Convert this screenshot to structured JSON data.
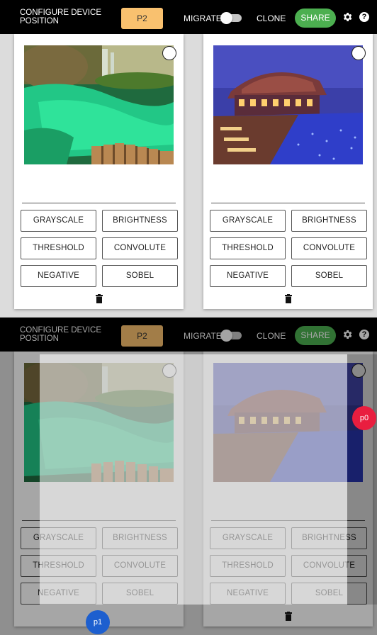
{
  "toolbar": {
    "title": "CONFIGURE DEVICE POSITION",
    "device_button": "P2",
    "migrate_label": "MIGRATE",
    "clone_label": "CLONE",
    "share_label": "SHARE",
    "icons": [
      "gear-icon",
      "help-icon"
    ]
  },
  "cards": [
    {
      "image": "lagoon-waterfall",
      "filters": [
        "GRAYSCALE",
        "BRIGHTNESS",
        "THRESHOLD",
        "CONVOLUTE",
        "NEGATIVE",
        "SOBEL"
      ]
    },
    {
      "image": "resort-pool-night",
      "filters": [
        "GRAYSCALE",
        "BRIGHTNESS",
        "THRESHOLD",
        "CONVOLUTE",
        "NEGATIVE",
        "SOBEL"
      ]
    }
  ],
  "device_badges": {
    "p0": "p0",
    "p1": "p1"
  },
  "colors": {
    "device_button": "#f9c16f",
    "share": "#4caf50",
    "p0": "#e91e3f",
    "p1": "#1d5fcf"
  }
}
